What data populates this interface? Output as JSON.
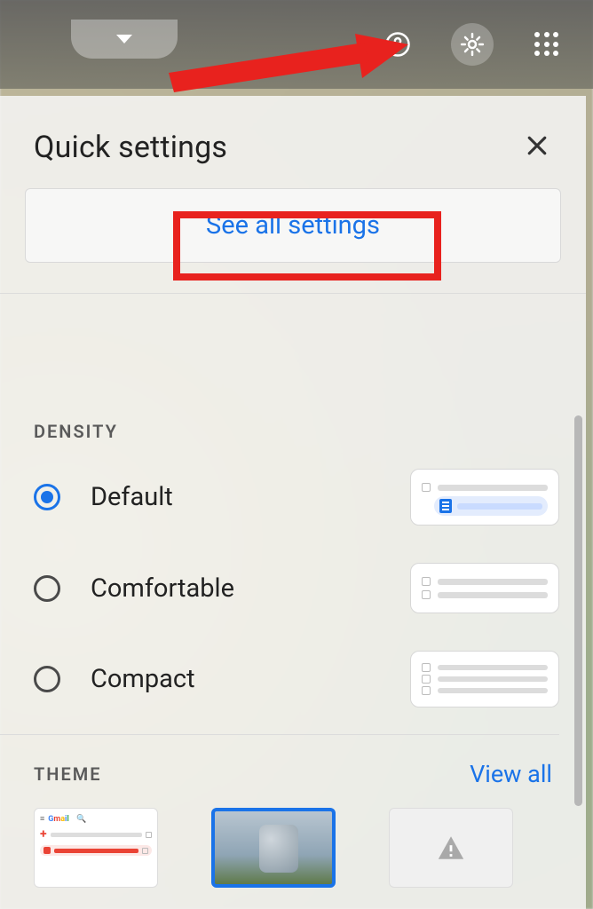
{
  "panel": {
    "title": "Quick settings",
    "see_all": "See all settings"
  },
  "density": {
    "label": "DENSITY",
    "options": [
      {
        "label": "Default",
        "selected": true
      },
      {
        "label": "Comfortable",
        "selected": false
      },
      {
        "label": "Compact",
        "selected": false
      }
    ]
  },
  "theme": {
    "label": "THEME",
    "view_all": "View all",
    "thumbs": [
      "gmail-default",
      "photo-selected",
      "blank"
    ]
  },
  "topbar": {
    "icons": [
      "caret-down",
      "help",
      "settings-gear",
      "apps-grid"
    ]
  },
  "annotation": {
    "arrow_target": "settings-gear",
    "highlight_target": "see-all-settings"
  }
}
